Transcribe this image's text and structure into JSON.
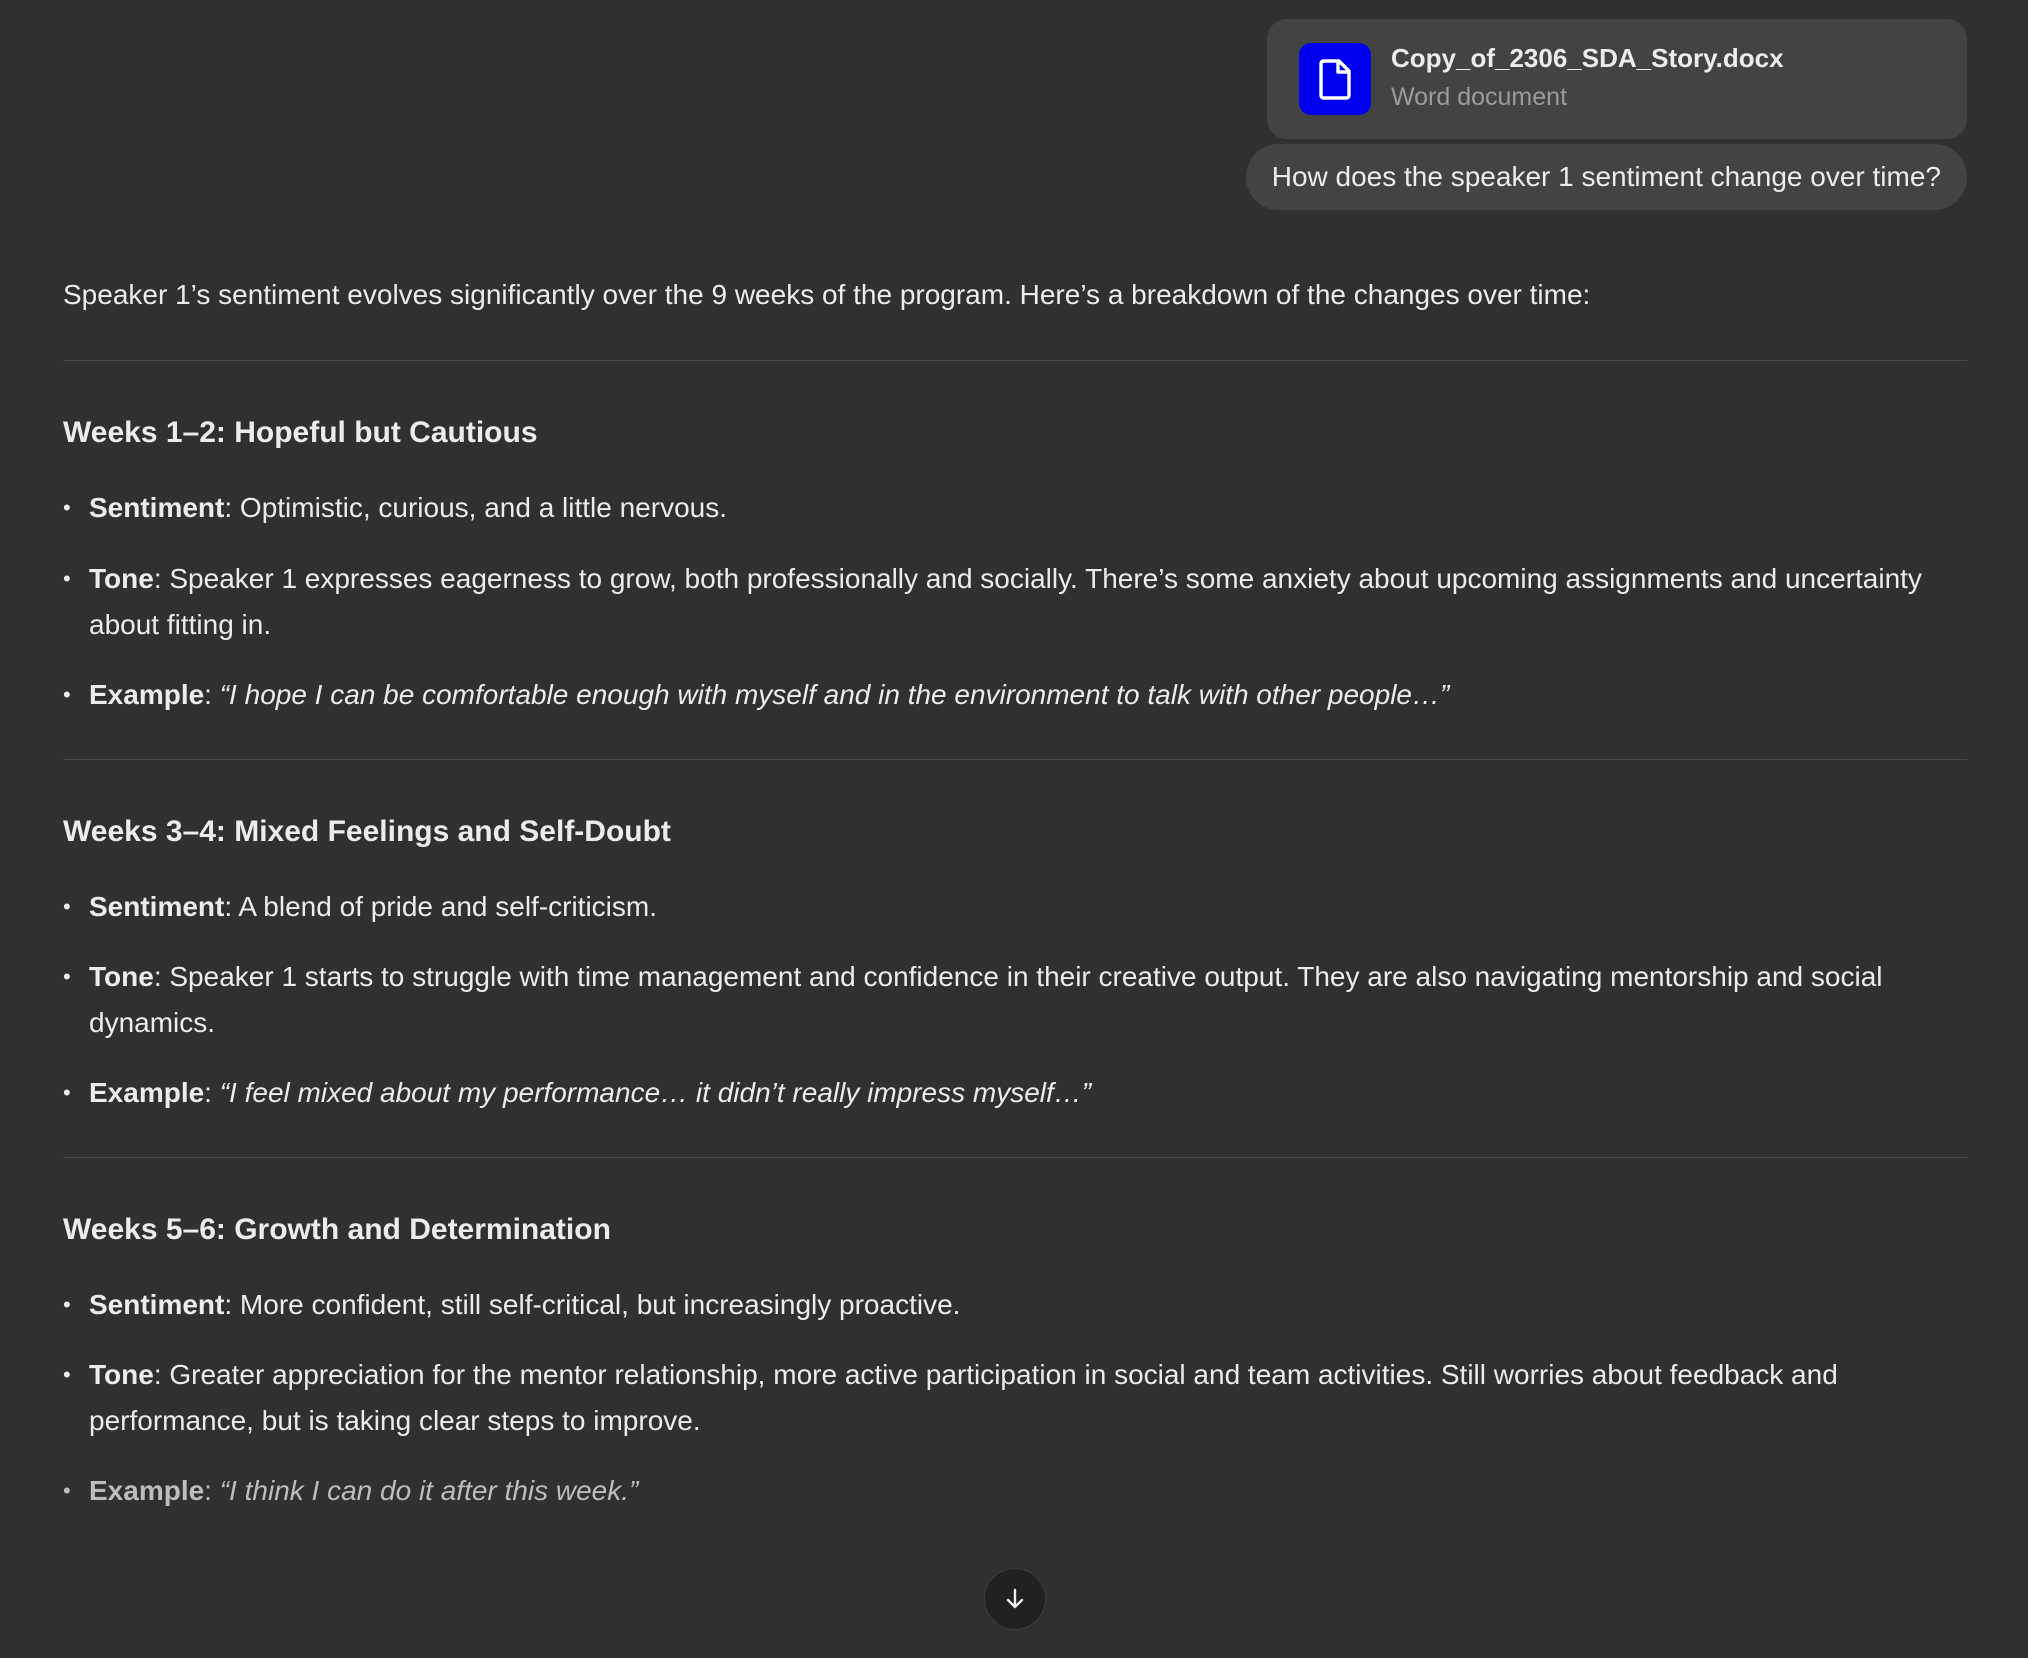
{
  "attachment": {
    "file_name": "Copy_of_2306_SDA_Story.docx",
    "file_type": "Word document",
    "icon": "document-icon",
    "icon_bg": "#0000ee"
  },
  "user_message": "How does the speaker 1 sentiment change over time?",
  "answer": {
    "intro": "Speaker 1’s sentiment evolves significantly over the 9 weeks of the program. Here’s a breakdown of the changes over time:",
    "sections": [
      {
        "heading": "Weeks 1–2: Hopeful but Cautious",
        "sentiment_label": "Sentiment",
        "sentiment": ": Optimistic, curious, and a little nervous.",
        "tone_label": "Tone",
        "tone": ": Speaker 1 expresses eagerness to grow, both professionally and socially. There’s some anxiety about upcoming assignments and uncertainty about fitting in.",
        "example_label": "Example",
        "example_sep": ": ",
        "example": "“I hope I can be comfortable enough with myself and in the environment to talk with other people…”"
      },
      {
        "heading": "Weeks 3–4: Mixed Feelings and Self-Doubt",
        "sentiment_label": "Sentiment",
        "sentiment": ": A blend of pride and self-criticism.",
        "tone_label": "Tone",
        "tone": ": Speaker 1 starts to struggle with time management and confidence in their creative output. They are also navigating mentorship and social dynamics.",
        "example_label": "Example",
        "example_sep": ": ",
        "example": "“I feel mixed about my performance… it didn’t really impress myself…”"
      },
      {
        "heading": "Weeks 5–6: Growth and Determination",
        "sentiment_label": "Sentiment",
        "sentiment": ": More confident, still self-critical, but increasingly proactive.",
        "tone_label": "Tone",
        "tone": ": Greater appreciation for the mentor relationship, more active participation in social and team activities. Still worries about feedback and performance, but is taking clear steps to improve.",
        "example_label": "Example",
        "example_sep": ": ",
        "example": "“I think I can do it after this week.”"
      }
    ]
  },
  "bullet_char": "•",
  "scroll_button": {
    "icon": "arrow-down-icon"
  }
}
